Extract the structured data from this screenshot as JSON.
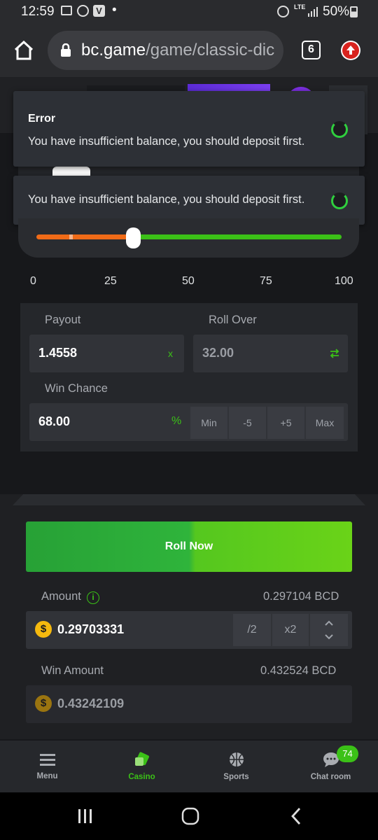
{
  "status_bar": {
    "time": "12:59",
    "dot": "•",
    "network": "LTE",
    "battery": "50%"
  },
  "browser": {
    "url_domain": "bc.game",
    "url_path": "/game/classic-dic",
    "tab_count": "6"
  },
  "toasts": [
    {
      "title": "Error",
      "message": "You have insufficient balance, you should deposit first."
    },
    {
      "message": "You have insufficient balance, you should deposit first."
    }
  ],
  "slider": {
    "ticks": [
      "0",
      "25",
      "50",
      "75",
      "100"
    ],
    "value": 32
  },
  "bet_panel": {
    "payout_label": "Payout",
    "payout_value": "1.4558",
    "payout_unit": "x",
    "roll_over_label": "Roll Over",
    "roll_over_value": "32.00",
    "win_chance_label": "Win Chance",
    "win_chance_value": "68.00",
    "win_chance_unit": "%",
    "quick_buttons": [
      "Min",
      "-5",
      "+5",
      "Max"
    ]
  },
  "roll_button": "Roll Now",
  "amount": {
    "label": "Amount",
    "bcd_value": "0.297104 BCD",
    "value": "0.29703331",
    "half": "/2",
    "double": "x2"
  },
  "win_amount": {
    "label": "Win Amount",
    "bcd_value": "0.432524 BCD",
    "value": "0.43242109"
  },
  "bottom_nav": {
    "items": [
      {
        "label": "Menu",
        "icon": "menu-icon"
      },
      {
        "label": "Casino",
        "icon": "casino-icon"
      },
      {
        "label": "Sports",
        "icon": "sports-icon"
      },
      {
        "label": "Chat room",
        "icon": "chat-icon"
      }
    ],
    "chat_badge": "74"
  },
  "colors": {
    "accent_green": "#3bc117",
    "brand_bg": "#17181b",
    "orange": "#f06b17"
  }
}
